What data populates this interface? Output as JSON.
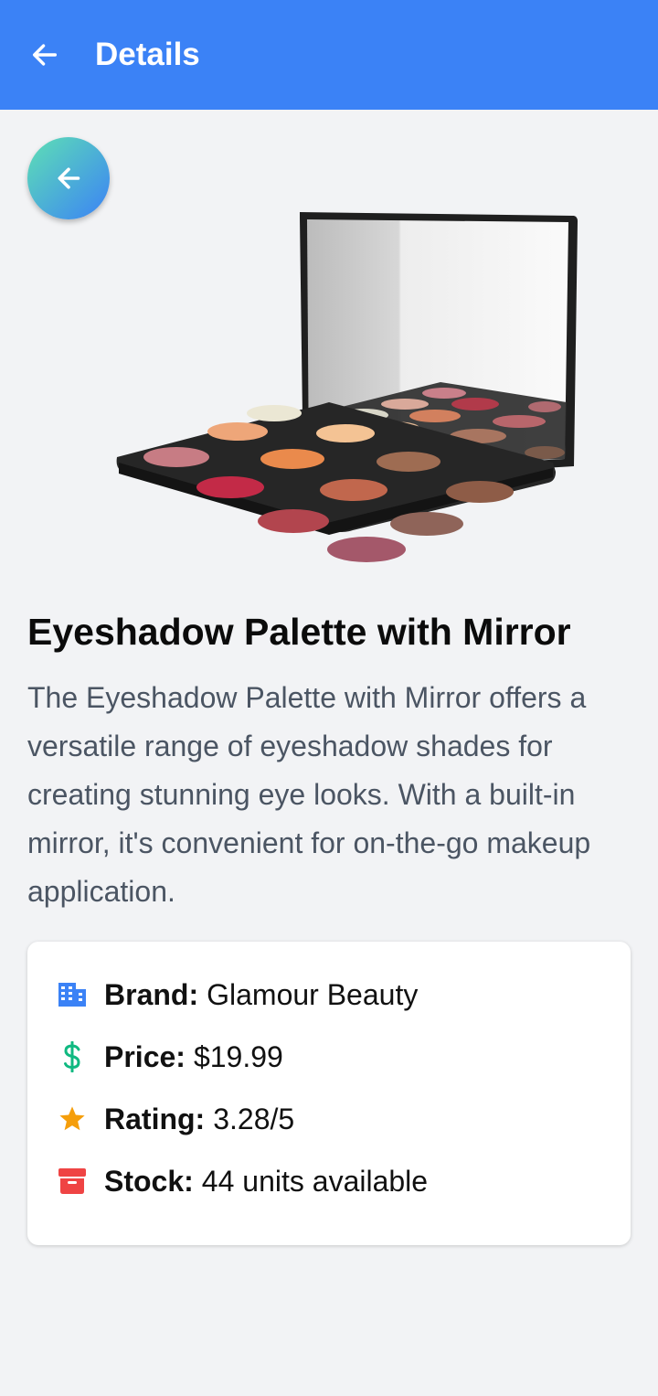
{
  "appbar": {
    "title": "Details",
    "back_icon": "arrow-left-icon",
    "color": "#3b82f6"
  },
  "fab": {
    "icon": "arrow-left-icon",
    "gradient": [
      "#5ee0b4",
      "#3b82f6"
    ]
  },
  "product": {
    "image_subject": "eyeshadow palette with mirror",
    "title": "Eyeshadow Palette with Mirror",
    "description": "The Eyeshadow Palette with Mirror offers a versatile range of eyeshadow shades for creating stunning eye looks. With a built-in mirror, it's convenient for on-the-go makeup application."
  },
  "details": {
    "brand": {
      "icon": "building-icon",
      "label": "Brand:",
      "value": "Glamour Beauty",
      "color": "#3b82f6"
    },
    "price": {
      "icon": "dollar-icon",
      "label": "Price:",
      "value": "$19.99",
      "color": "#10b981"
    },
    "rating": {
      "icon": "star-icon",
      "label": "Rating:",
      "value": "3.28/5",
      "color": "#f59e0b"
    },
    "stock": {
      "icon": "archive-box-icon",
      "label": "Stock:",
      "value": "44 units available",
      "color": "#ef4444"
    }
  }
}
